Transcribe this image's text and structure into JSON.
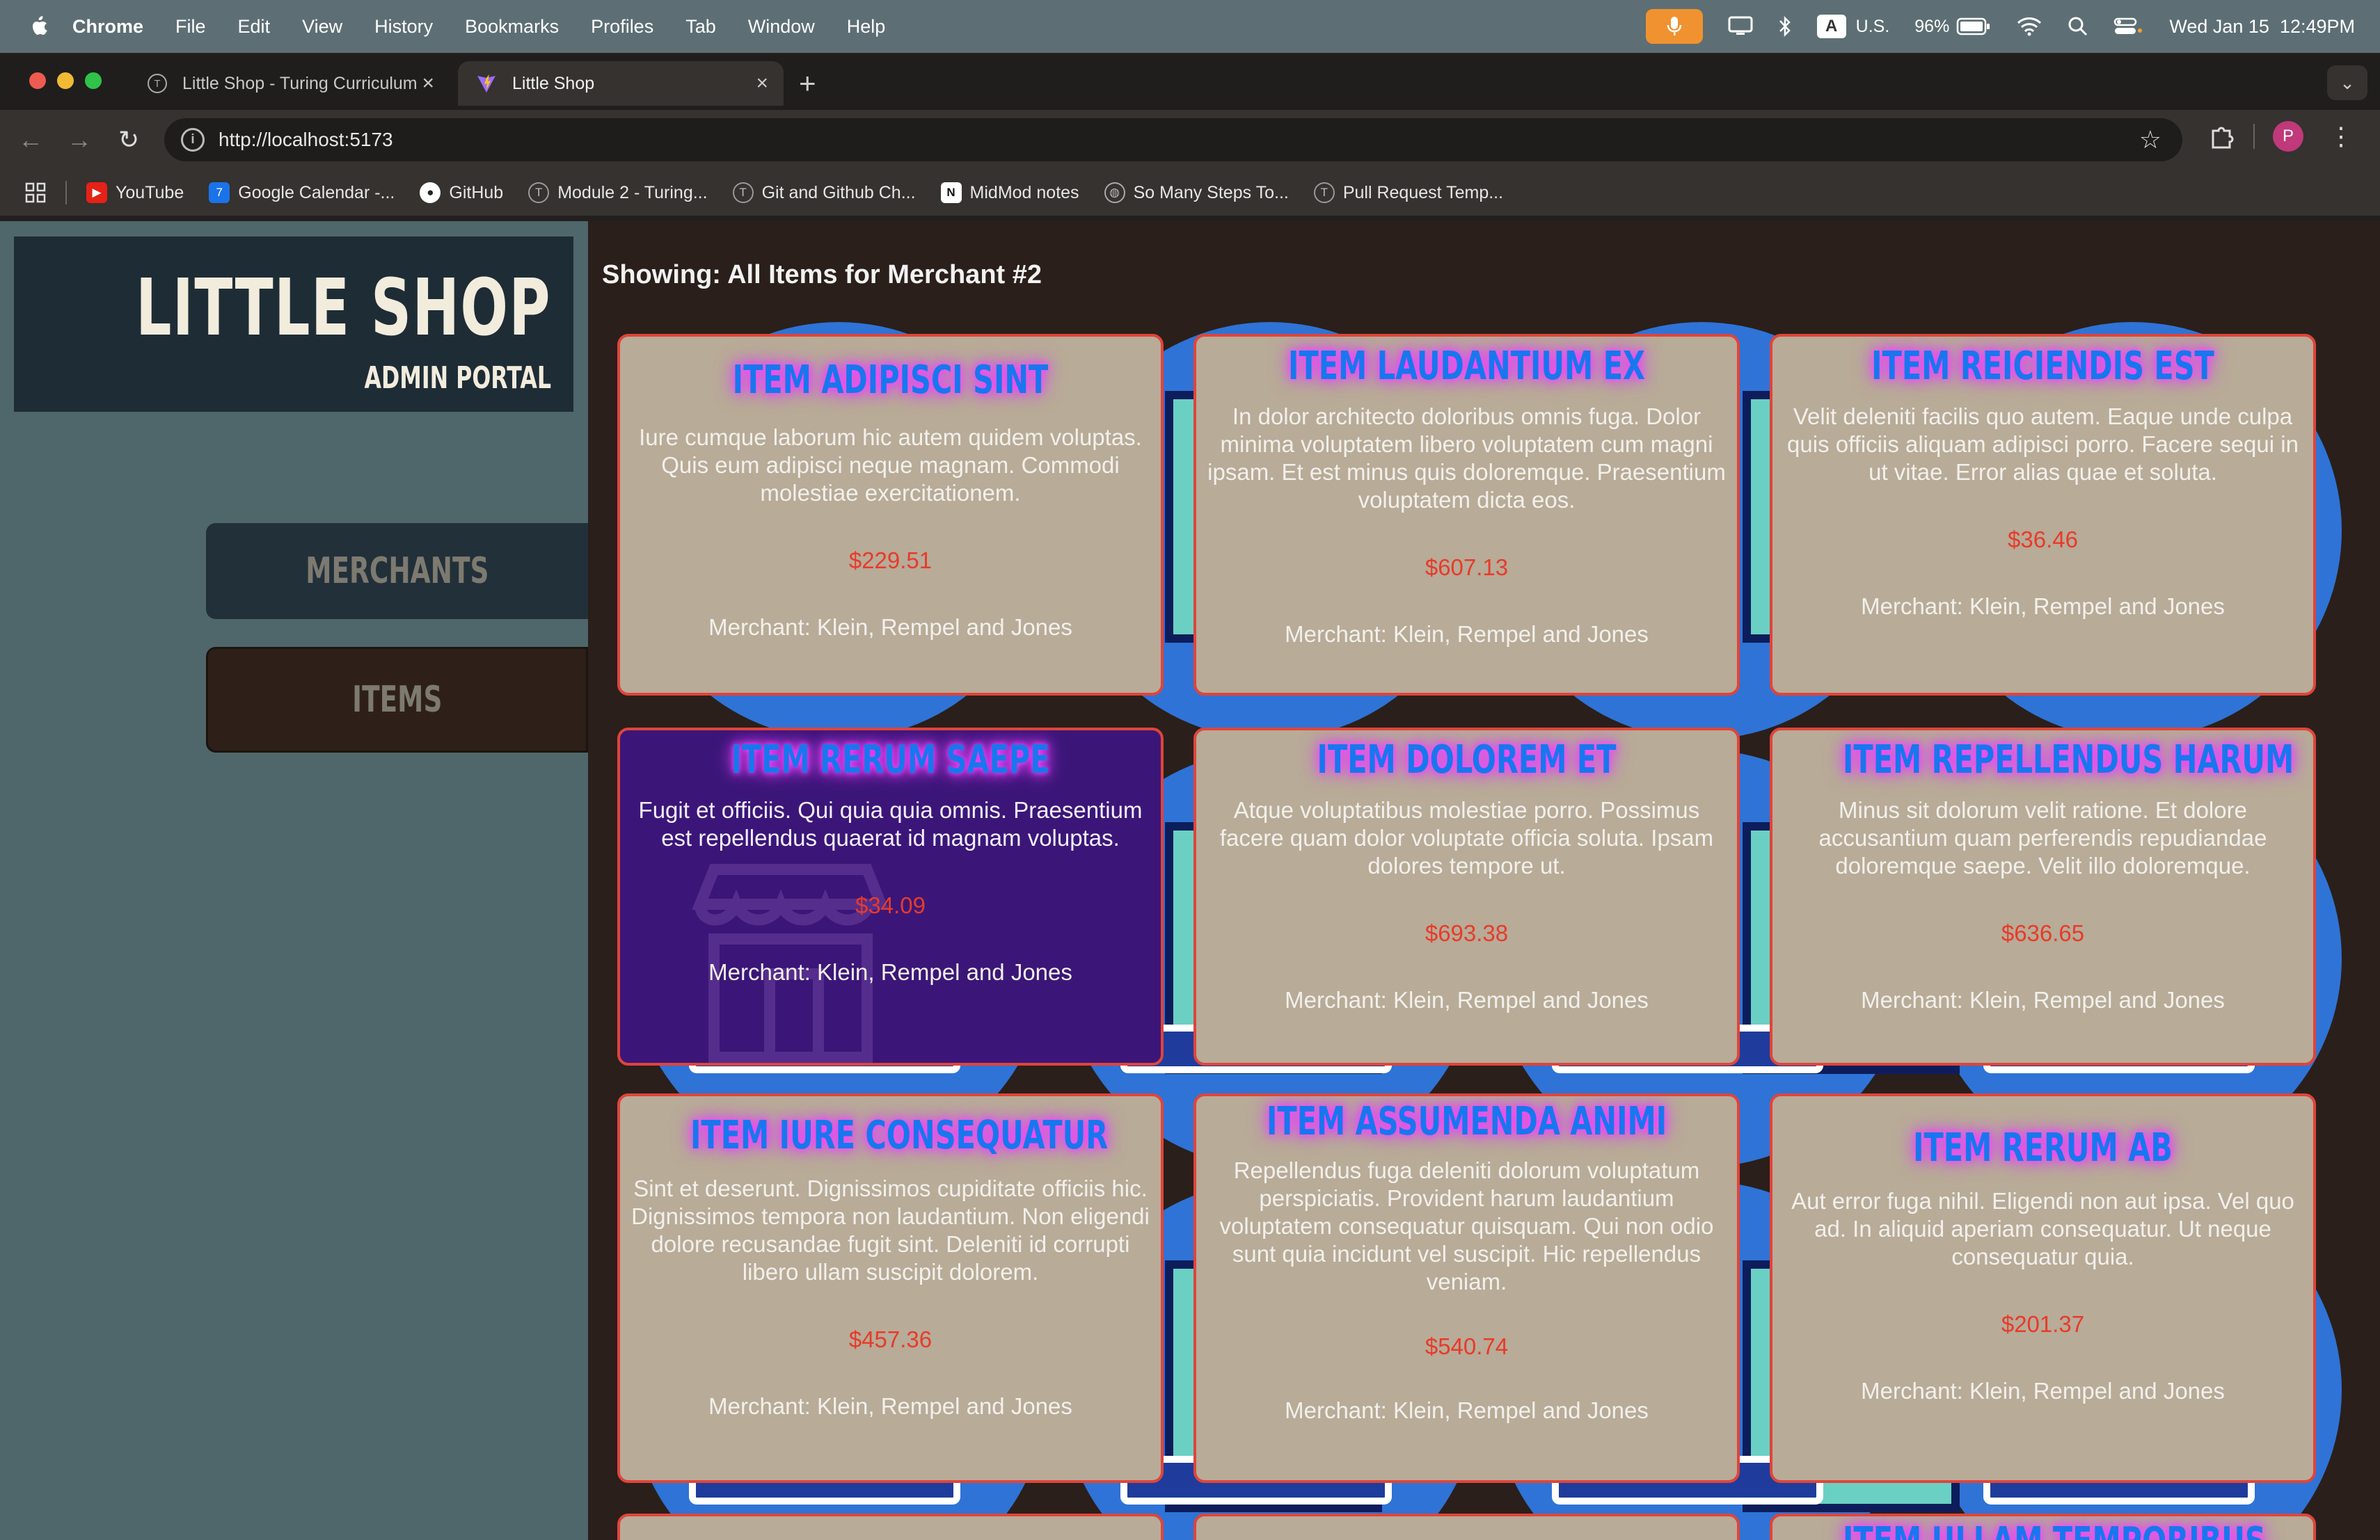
{
  "menubar": {
    "app": "Chrome",
    "items": [
      "File",
      "Edit",
      "View",
      "History",
      "Bookmarks",
      "Profiles",
      "Tab",
      "Window",
      "Help"
    ],
    "input_source": "U.S.",
    "input_letter": "A",
    "battery": "96%",
    "datetime": "Wed Jan 15  12:49PM"
  },
  "browser": {
    "tabs": [
      {
        "title": "Little Shop - Turing Curriculum"
      },
      {
        "title": "Little Shop"
      }
    ],
    "url": "http://localhost:5173",
    "profile_initial": "P",
    "bookmarks": [
      {
        "label": "YouTube",
        "icon": "youtube-icon",
        "color": "#e62117"
      },
      {
        "label": "Google Calendar -...",
        "icon": "calendar-icon",
        "color": "#1a73e8"
      },
      {
        "label": "GitHub",
        "icon": "github-icon",
        "color": "#ffffff"
      },
      {
        "label": "Module 2 - Turing...",
        "icon": "turing-icon",
        "color": "#555555"
      },
      {
        "label": "Git and Github Ch...",
        "icon": "turing-icon",
        "color": "#555555"
      },
      {
        "label": "MidMod notes",
        "icon": "notion-icon",
        "color": "#ffffff"
      },
      {
        "label": "So Many Steps To...",
        "icon": "globe-icon",
        "color": "#888888"
      },
      {
        "label": "Pull Request Temp...",
        "icon": "turing-icon",
        "color": "#555555"
      }
    ]
  },
  "sidebar": {
    "title": "LITTLE SHOP",
    "subtitle": "ADMIN PORTAL",
    "nav": [
      {
        "label": "MERCHANTS"
      },
      {
        "label": "ITEMS"
      }
    ]
  },
  "main": {
    "heading": "Showing: All Items for Merchant #2",
    "items": [
      {
        "name": "ITEM ADIPISCI SINT",
        "description": "Iure cumque laborum hic autem quidem voluptas. Quis eum adipisci neque magnam. Commodi molestiae exercitationem.",
        "price": "$229.51",
        "merchant": "Merchant: Klein, Rempel and Jones"
      },
      {
        "name": "ITEM LAUDANTIUM EX",
        "description": "In dolor architecto doloribus omnis fuga. Dolor minima voluptatem libero voluptatem cum magni ipsam. Et est minus quis doloremque. Praesentium voluptatem dicta eos.",
        "price": "$607.13",
        "merchant": "Merchant: Klein, Rempel and Jones"
      },
      {
        "name": "ITEM REICIENDIS EST",
        "description": "Velit deleniti facilis quo autem. Eaque unde culpa quis officiis aliquam adipisci porro. Facere sequi in ut vitae. Error alias quae et soluta.",
        "price": "$36.46",
        "merchant": "Merchant: Klein, Rempel and Jones"
      },
      {
        "name": "ITEM RERUM SAEPE",
        "description": "Fugit et officiis. Qui quia quia omnis. Praesentium est repellendus quaerat id magnam voluptas.",
        "price": "$34.09",
        "merchant": "Merchant: Klein, Rempel and Jones"
      },
      {
        "name": "ITEM DOLOREM ET",
        "description": "Atque voluptatibus molestiae porro. Possimus facere quam dolor voluptate officia soluta. Ipsam dolores tempore ut.",
        "price": "$693.38",
        "merchant": "Merchant: Klein, Rempel and Jones"
      },
      {
        "name": "ITEM REPELLENDUS HARUM",
        "description": "Minus sit dolorum velit ratione. Et dolore accusantium quam perferendis repudiandae doloremque saepe. Velit illo doloremque.",
        "price": "$636.65",
        "merchant": "Merchant: Klein, Rempel and Jones"
      },
      {
        "name": "ITEM IURE CONSEQUATUR",
        "description": "Sint et deserunt. Dignissimos cupiditate officiis hic. Dignissimos tempora non laudantium. Non eligendi dolore recusandae fugit sint. Deleniti id corrupti libero ullam suscipit dolorem.",
        "price": "$457.36",
        "merchant": "Merchant: Klein, Rempel and Jones"
      },
      {
        "name": "ITEM ASSUMENDA ANIMI",
        "description": "Repellendus fuga deleniti dolorum voluptatum perspiciatis. Provident harum laudantium voluptatem consequatur quisquam. Qui non odio sunt quia incidunt vel suscipit. Hic repellendus veniam.",
        "price": "$540.74",
        "merchant": "Merchant: Klein, Rempel and Jones"
      },
      {
        "name": "ITEM RERUM AB",
        "description": "Aut error fuga nihil. Eligendi non aut ipsa. Vel quo ad. In aliquid aperiam consequatur. Ut neque consequatur quia.",
        "price": "$201.37",
        "merchant": "Merchant: Klein, Rempel and Jones"
      },
      {
        "name": "ITEM ULLAM TEMPORIBUS",
        "description": "",
        "price": "",
        "merchant": ""
      }
    ]
  },
  "colors": {
    "sidebar_bg": "#4f676a",
    "brand_bg": "#1e2c36",
    "card_bg": "#b8ab97",
    "card_border": "#e0443a",
    "card_active_bg": "#3b1678",
    "item_name": "#1877ee",
    "price": "#e83a2a"
  }
}
